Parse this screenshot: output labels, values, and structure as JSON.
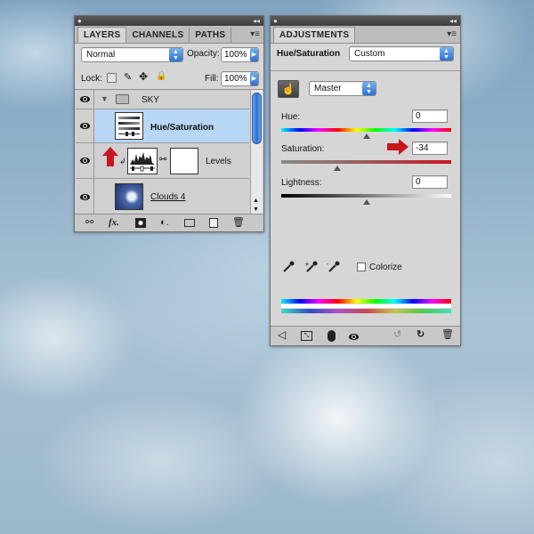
{
  "layers_panel": {
    "tabs": [
      "LAYERS",
      "CHANNELS",
      "PATHS"
    ],
    "blend_mode": "Normal",
    "opacity_label": "Opacity:",
    "opacity_value": "100%",
    "lock_label": "Lock:",
    "fill_label": "Fill:",
    "fill_value": "100%",
    "layers": [
      {
        "name": "SKY",
        "type": "group"
      },
      {
        "name": "Hue/Saturation",
        "type": "adjustment",
        "selected": true
      },
      {
        "name": "Levels",
        "type": "adjustment"
      },
      {
        "name": "Clouds 4",
        "type": "smart-object"
      }
    ]
  },
  "adjustments_panel": {
    "tab": "ADJUSTMENTS",
    "adjustment_name": "Hue/Saturation",
    "preset": "Custom",
    "channel": "Master",
    "hue_label": "Hue:",
    "hue_value": "0",
    "saturation_label": "Saturation:",
    "saturation_value": "-34",
    "lightness_label": "Lightness:",
    "lightness_value": "0",
    "colorize_label": "Colorize",
    "colorize_checked": false
  },
  "colors": {
    "annotation_arrow": "#c8161e",
    "selection_blue": "#b8d6f5",
    "select_blue": "#2f6fd0"
  },
  "sliders": {
    "hue_fraction": 0.5,
    "saturation_fraction": 0.33,
    "lightness_fraction": 0.5
  }
}
